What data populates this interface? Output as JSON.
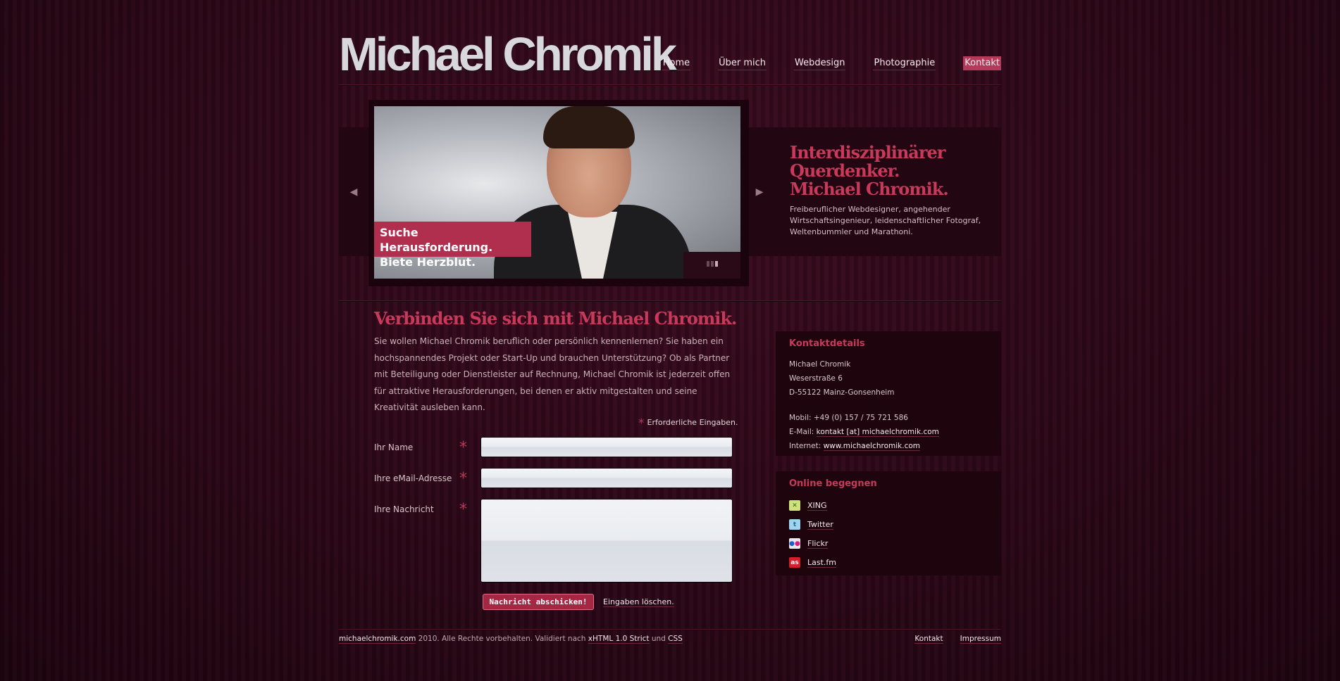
{
  "header": {
    "logo": "Michael Chromik",
    "nav": [
      "Home",
      "Über mich",
      "Webdesign",
      "Photographie",
      "Kontakt"
    ]
  },
  "slider": {
    "caption_line1": "Suche Herausforderung.",
    "caption_line2": "Biete Herzblut.",
    "tagline_title": [
      "Interdisziplinärer",
      "Querdenker.",
      "Michael Chromik."
    ],
    "tagline_text": "Freiberuflicher Webdesigner, angehender Wirtschaftsingenieur, leidenschaftlicher Fotograf, Weltenbummler und Marathoni.",
    "prev_icon": "arrow-left-icon",
    "next_icon": "arrow-right-icon"
  },
  "main": {
    "title": "Verbinden Sie sich mit Michael Chromik.",
    "intro": "Sie wollen Michael Chromik beruflich oder persönlich kennenlernen? Sie haben ein hochspannendes Projekt oder Start-Up und brauchen Unterstützung? Ob als Partner mit Beteiligung oder Dienstleister auf Rechnung, Michael Chromik ist jederzeit offen für attraktive Herausforderungen, bei denen er aktiv mitgestalten und seine Kreativität ausleben kann.",
    "required_note": "Erforderliche Eingaben.",
    "required_mark": "*",
    "fields": {
      "name": "Ihr Name",
      "email": "Ihre eMail-Adresse",
      "message": "Ihre Nachricht"
    },
    "submit_label": "Nachricht abschicken!",
    "reset_label": "Eingaben löschen."
  },
  "sidebar": {
    "contact": {
      "title": "Kontaktdetails",
      "name": "Michael Chromik",
      "street": "Weserstraße 6",
      "city": "D-55122 Mainz-Gonsenheim",
      "mobile": "Mobil: +49 (0) 157 / 75 721 586",
      "email_label": "E-Mail:",
      "email": "kontakt [at] michaelchromik.com",
      "web_label": "Internet:",
      "web": "www.michaelchromik.com"
    },
    "online": {
      "title": "Online begegnen",
      "items": [
        {
          "label": "XING",
          "icon": "xing-icon",
          "color": "#cfe37a"
        },
        {
          "label": "Twitter",
          "icon": "twitter-icon",
          "color": "#9fd3ee"
        },
        {
          "label": "Flickr",
          "icon": "flickr-icon",
          "color": "#e8e8ee"
        },
        {
          "label": "Last.fm",
          "icon": "lastfm-icon",
          "color": "#d21f2a"
        }
      ]
    }
  },
  "footer": {
    "site": "michaelchromik.com",
    "text1": " 2010. Alle Rechte vorbehalten. Validiert nach ",
    "xhtml": "xHTML 1.0 Strict",
    "text2": " und ",
    "css": "CSS",
    "links": [
      "Kontakt",
      "Impressum"
    ]
  },
  "colors": {
    "accent": "#c8395c",
    "background": "#2a0716",
    "button": "#a42844"
  }
}
